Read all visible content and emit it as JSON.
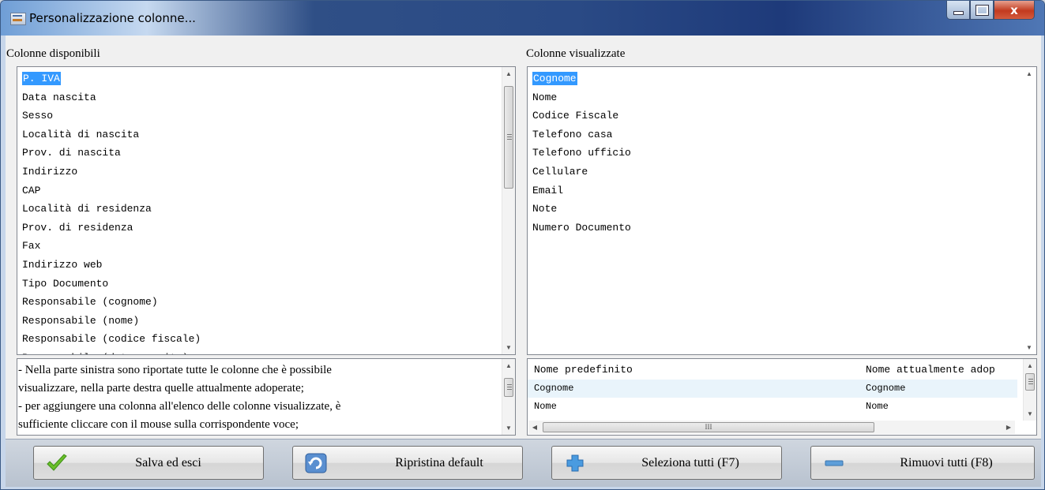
{
  "window": {
    "title": "Personalizzazione colonne...",
    "close_glyph": "x"
  },
  "left_panel": {
    "label": "Colonne disponibili",
    "items": [
      "P. IVA",
      "Data nascita",
      "Sesso",
      "Località di nascita",
      "Prov. di nascita",
      "Indirizzo",
      "CAP",
      "Località di residenza",
      "Prov. di residenza",
      "Fax",
      "Indirizzo web",
      "Tipo Documento",
      "Responsabile (cognome)",
      "Responsabile (nome)",
      "Responsabile (codice fiscale)",
      "Responsabile (data nascita)"
    ],
    "selected_item": "P. IVA"
  },
  "right_panel": {
    "label": "Colonne visualizzate",
    "items": [
      "Cognome",
      "Nome",
      "Codice Fiscale",
      "Telefono casa",
      "Telefono ufficio",
      "Cellulare",
      "Email",
      "Note",
      "Numero Documento"
    ],
    "selected_item": "Cognome"
  },
  "help_text": [
    "- Nella parte sinistra sono riportate tutte le colonne che è possibile",
    "visualizzare, nella parte destra quelle attualmente adoperate;",
    "- per aggiungere una colonna all'elenco delle colonne visualizzate, è",
    "sufficiente cliccare con il mouse sulla corrispondente voce;"
  ],
  "name_grid": {
    "headers": [
      "Nome predefinito",
      "Nome attualmente adop"
    ],
    "rows": [
      [
        "Cognome",
        "Cognome"
      ],
      [
        "Nome",
        "Nome"
      ]
    ],
    "hscroll_grip": "III"
  },
  "buttons": {
    "save": "Salva ed esci",
    "reset": "Ripristina default",
    "select_all": "Seleziona tutti (F7)",
    "remove_all": "Rimuovi tutti (F8)"
  },
  "icons": {
    "save": "checkmark-icon",
    "reset": "refresh-icon",
    "select_all": "plus-icon",
    "remove_all": "minus-icon"
  },
  "colors": {
    "selection": "#3399ff",
    "check": "#6abf2a",
    "plus": "#4a9be0"
  }
}
